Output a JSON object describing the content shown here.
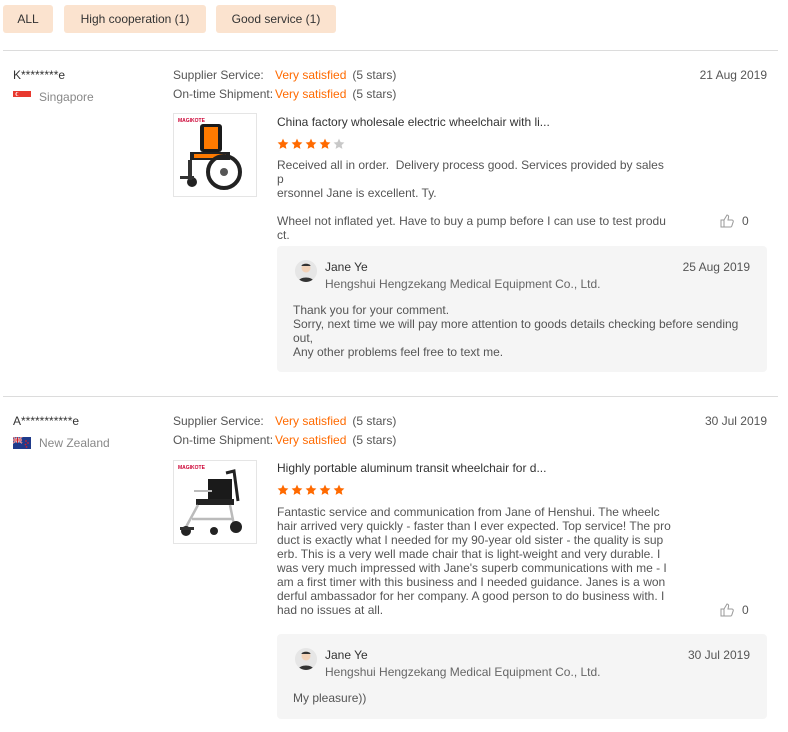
{
  "filters": [
    {
      "label": "ALL"
    },
    {
      "label": "High cooperation (1)"
    },
    {
      "label": "Good service (1)"
    }
  ],
  "reviews": [
    {
      "user": "K********e",
      "country": "Singapore",
      "supplier_service_label": "Supplier Service:",
      "supplier_service_value": "Very satisfied",
      "supplier_service_stars": "(5 stars)",
      "shipment_label": "On-time Shipment:",
      "shipment_value": "Very satisfied",
      "shipment_stars": "(5 stars)",
      "date": "21 Aug 2019",
      "product_title": "China factory wholesale electric wheelchair with li...",
      "rating": 4,
      "text": "Received all in order.  Delivery process good. Services provided by sales p\nersonnel Jane is excellent. Ty.\n\nWheel not inflated yet. Have to buy a pump before I can use to test produ\nct.",
      "likes": "0",
      "reply": {
        "name": "Jane Ye",
        "company": "Hengshui Hengzekang Medical Equipment Co., Ltd.",
        "date": "25 Aug 2019",
        "text": "Thank you for your comment.\nSorry, next time we will pay more attention to goods details checking before sending\nout,\nAny other problems feel free to text me."
      }
    },
    {
      "user": "A***********e",
      "country": "New Zealand",
      "supplier_service_label": "Supplier Service:",
      "supplier_service_value": "Very satisfied",
      "supplier_service_stars": "(5 stars)",
      "shipment_label": "On-time Shipment:",
      "shipment_value": "Very satisfied",
      "shipment_stars": "(5 stars)",
      "date": "30 Jul 2019",
      "product_title": "Highly portable aluminum transit wheelchair for d...",
      "rating": 5,
      "text": "Fantastic service and communication from Jane of Henshui. The wheelc\nhair arrived very quickly - faster than I ever expected. Top service! The pro\nduct is exactly what I needed for my 90-year old sister - the quality is sup\nerb. This is a very well made chair that is light-weight and very durable. I\nwas very much impressed with Jane's superb communications with me - I\nam a first timer with this business and I needed guidance. Janes is a won\nderful ambassador for her company. A good person to do business with. I\nhad no issues at all.",
      "likes": "0",
      "reply": {
        "name": "Jane Ye",
        "company": "Hengshui Hengzekang Medical Equipment Co., Ltd.",
        "date": "30 Jul 2019",
        "text": "My pleasure))"
      }
    }
  ],
  "colors": {
    "accent": "#ff6a00",
    "chip_bg": "#fbe3cf",
    "reply_bg": "#f5f5f5"
  }
}
